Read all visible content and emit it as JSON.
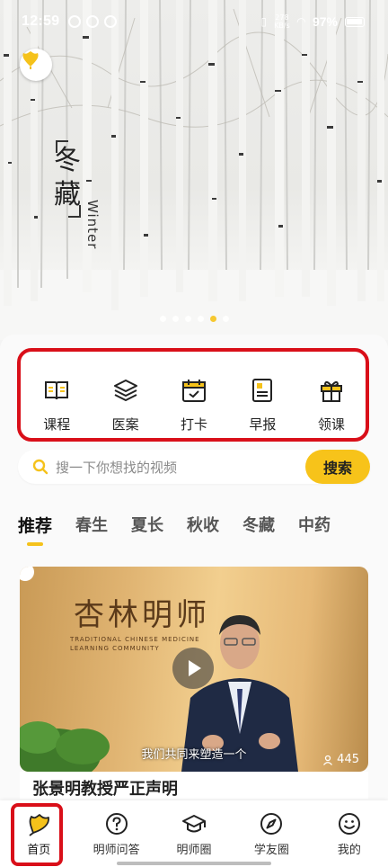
{
  "status_bar": {
    "time": "12:59",
    "net_speed_top": "278",
    "net_speed_unit": "KB/s",
    "battery": "97%"
  },
  "hero": {
    "title_chars": [
      "冬",
      "藏"
    ],
    "subtitle_en": "Winter",
    "carousel_total": 6,
    "carousel_active_index": 4
  },
  "quick_actions": [
    {
      "label": "课程",
      "icon": "book-icon"
    },
    {
      "label": "医案",
      "icon": "layers-icon"
    },
    {
      "label": "打卡",
      "icon": "calendar-check-icon"
    },
    {
      "label": "早报",
      "icon": "document-icon"
    },
    {
      "label": "领课",
      "icon": "gift-icon"
    }
  ],
  "search": {
    "placeholder": "搜一下你想找的视频",
    "button_label": "搜索"
  },
  "tabs": [
    "推荐",
    "春生",
    "夏长",
    "秋收",
    "冬藏",
    "中药"
  ],
  "active_tab": 0,
  "video": {
    "brand_text": "杏林明师",
    "caption": "我们共同来塑造一个",
    "view_count": "445",
    "title": "张景明教授严正声明"
  },
  "bottom_nav": [
    {
      "label": "首页",
      "icon": "ginkgo-home-icon"
    },
    {
      "label": "明师问答",
      "icon": "question-icon"
    },
    {
      "label": "明师圈",
      "icon": "graduation-cap-icon"
    },
    {
      "label": "学友圈",
      "icon": "compass-icon"
    },
    {
      "label": "我的",
      "icon": "smiley-icon"
    }
  ],
  "colors": {
    "accent": "#f5c21b",
    "highlight_annotation": "#d90f19"
  }
}
